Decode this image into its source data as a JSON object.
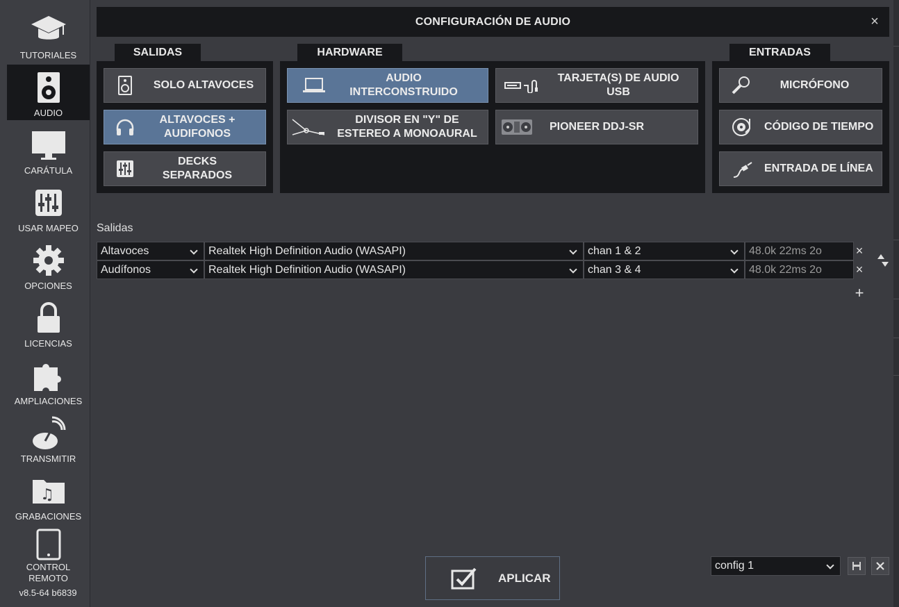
{
  "sidebar": {
    "items": [
      {
        "label": "TUTORIALES",
        "icon": "graduation-cap-icon"
      },
      {
        "label": "AUDIO",
        "icon": "speaker-icon"
      },
      {
        "label": "CARÁTULA",
        "icon": "monitor-icon"
      },
      {
        "label": "USAR MAPEO",
        "icon": "mixer-sliders-icon"
      },
      {
        "label": "OPCIONES",
        "icon": "gear-icon"
      },
      {
        "label": "LICENCIAS",
        "icon": "lock-icon"
      },
      {
        "label": "AMPLIACIONES",
        "icon": "puzzle-icon"
      },
      {
        "label": "TRANSMITIR",
        "icon": "broadcast-dish-icon"
      },
      {
        "label": "GRABACIONES",
        "icon": "music-folder-icon"
      },
      {
        "label": "CONTROL REMOTO",
        "icon": "tablet-icon"
      }
    ],
    "version": "v8.5-64 b6839"
  },
  "dialog": {
    "title": "CONFIGURACIÓN DE AUDIO",
    "close_symbol": "×"
  },
  "salidas": {
    "tab": "SALIDAS",
    "buttons": [
      {
        "label": "SOLO ALTAVOCES",
        "selected": false
      },
      {
        "label": "ALTAVOCES + AUDIFONOS",
        "selected": true
      },
      {
        "label": "DECKS SEPARADOS",
        "selected": false
      }
    ]
  },
  "hardware": {
    "tab": "HARDWARE",
    "buttons": [
      {
        "label": "AUDIO INTERCONSTRUIDO",
        "selected": true
      },
      {
        "label": "TARJETA(S) DE AUDIO USB",
        "selected": false
      },
      {
        "label": "DIVISOR EN \"Y\" DE ESTEREO A MONOAURAL",
        "selected": false
      },
      {
        "label": "PIONEER DDJ-SR",
        "selected": false
      }
    ]
  },
  "entradas": {
    "tab": "ENTRADAS",
    "buttons": [
      {
        "label": "MICRÓFONO"
      },
      {
        "label": "CÓDIGO DE TIEMPO"
      },
      {
        "label": "ENTRADA DE LÍNEA"
      }
    ]
  },
  "outputs": {
    "label": "Salidas",
    "rows": [
      {
        "role": "Altavoces",
        "device": "Realtek High Definition Audio (WASAPI)",
        "channels": "chan 1 & 2",
        "info": "48.0k 22ms 2o"
      },
      {
        "role": "Audífonos",
        "device": "Realtek High Definition Audio (WASAPI)",
        "channels": "chan 3 & 4",
        "info": "48.0k 22ms 2o"
      }
    ],
    "remove_symbol": "×",
    "add_symbol": "+"
  },
  "footer": {
    "apply_label": "APLICAR",
    "config_value": "config 1"
  },
  "colors": {
    "selected_button": "#5a7597",
    "panel_bg": "#17181b",
    "window_bg": "#3a3b40"
  }
}
